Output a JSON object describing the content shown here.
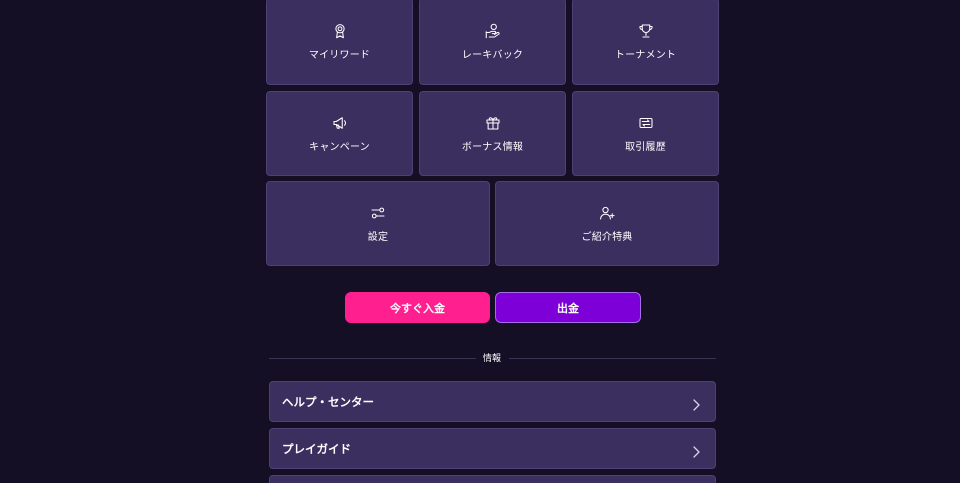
{
  "tiles": [
    {
      "label": "マイリワード",
      "icon": "award-icon"
    },
    {
      "label": "レーキバック",
      "icon": "coin-hand-icon"
    },
    {
      "label": "トーナメント",
      "icon": "trophy-icon"
    },
    {
      "label": "キャンペーン",
      "icon": "megaphone-icon"
    },
    {
      "label": "ボーナス情報",
      "icon": "gift-icon"
    },
    {
      "label": "取引履歴",
      "icon": "transactions-icon"
    },
    {
      "label": "設定",
      "icon": "settings-toggle-icon"
    },
    {
      "label": "ご紹介特典",
      "icon": "add-user-icon"
    }
  ],
  "actions": {
    "deposit_label": "今すぐ入金",
    "withdraw_label": "出金"
  },
  "info": {
    "heading": "情報",
    "items": [
      {
        "label": "ヘルプ・センター"
      },
      {
        "label": "プレイガイド"
      }
    ]
  },
  "colors": {
    "background": "#140f24",
    "tile": "#3a2f5e",
    "tile_border": "#4c4275",
    "deposit": "#ff1f8f",
    "withdraw": "#7d00d8"
  }
}
